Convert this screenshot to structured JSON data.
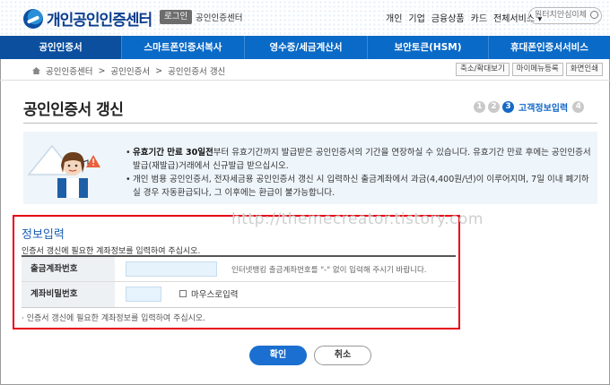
{
  "header": {
    "logo_text": "개인공인인증센터",
    "login_label": "로그인",
    "center_link": "공인인증센터",
    "links": [
      "개인",
      "기업",
      "금융상품",
      "카드",
      "전체서비스 ▾"
    ],
    "search_placeholder": "원터치안심이체"
  },
  "nav": {
    "items": [
      "공인인증서",
      "스마트폰인증서복사",
      "영수증/세금계산서",
      "보안토큰(HSM)",
      "휴대폰인증서서비스"
    ]
  },
  "breadcrumb": {
    "items": [
      "공인인증센터",
      ">",
      "공인인증서",
      ">",
      "공인인증서 갱신"
    ],
    "buttons": [
      "축소/확대보기",
      "마이메뉴등록",
      "화면인쇄"
    ]
  },
  "page": {
    "title": "공인인증서 갱신",
    "steps": [
      "1",
      "2",
      "3",
      "4"
    ],
    "active_step_label": "고객정보입력"
  },
  "notice": {
    "line1_bold": "유효기간 만료 30일전",
    "line1_rest": "부터 유효기간까지 발급받은 공인인증서의 기간을 연장하실 수 있습니다. 유효기간 만료 후에는 공인인증서 발급(재발급)거래에서 신규발급 받으십시오.",
    "line2": "개인 범용 공인인증서, 전자세금용 공인인증서 갱신 시 입력하신 출금계좌에서 과금(4,400원/년)이 이루어지며, 7일 이내 폐기하실 경우 자동환급되나, 그 이후에는 환급이 불가능합니다."
  },
  "form": {
    "section_title": "정보입력",
    "description": "인증서 갱신에 필요한 계좌정보를 입력하여 주십시오.",
    "account_label": "출금계좌번호",
    "account_value": "",
    "account_hint": "인터넷뱅킹 출금계좌번호를 \"-\" 없이 입력해 주시기 바랍니다.",
    "password_label": "계좌비밀번호",
    "password_value": "",
    "mouse_input_label": "마우스로입력",
    "footnote": "· 인증서 갱신에 필요한 계좌정보를 입력하여 주십시오."
  },
  "watermark": "http://themecreator.tistory.com",
  "buttons": {
    "confirm": "확인",
    "cancel": "취소"
  },
  "colors": {
    "nav": "#0a6ac7",
    "accent": "#1b6fd0",
    "highlight_box": "#e60012"
  }
}
